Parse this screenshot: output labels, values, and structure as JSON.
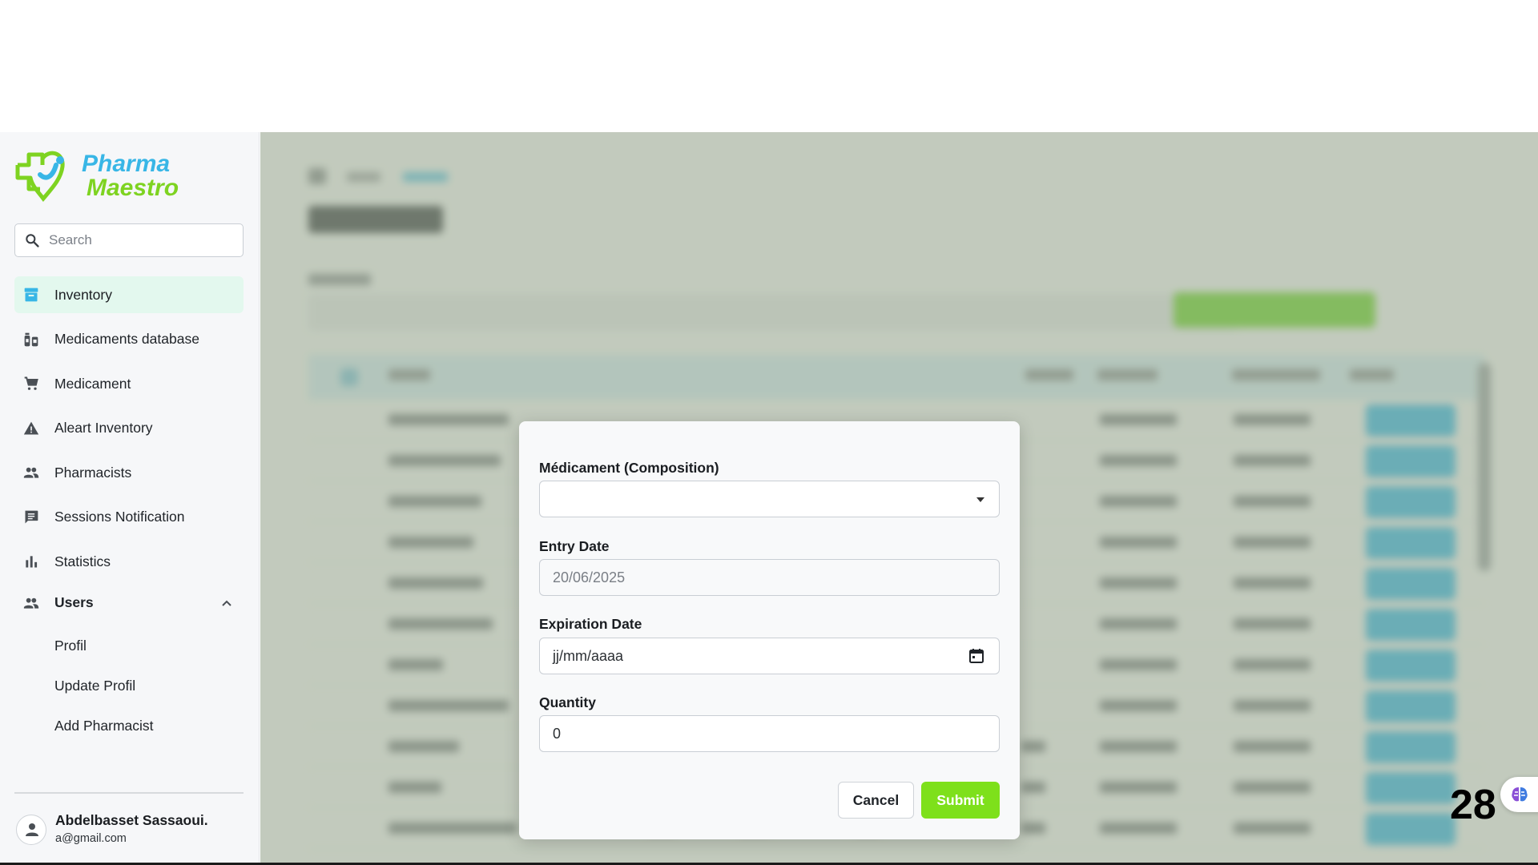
{
  "brand": {
    "line1": "Pharma",
    "line2": "Maestro",
    "color_green": "#7ed321",
    "color_blue": "#38b6e6"
  },
  "search": {
    "placeholder": "Search"
  },
  "sidebar": {
    "items": [
      {
        "label": "Inventory",
        "icon": "inventory-icon",
        "active": true
      },
      {
        "label": "Medicaments database",
        "icon": "medicaments-icon"
      },
      {
        "label": "Medicament",
        "icon": "cart-icon"
      },
      {
        "label": "Aleart Inventory",
        "icon": "warning-icon"
      },
      {
        "label": "Pharmacists",
        "icon": "people-icon"
      },
      {
        "label": "Sessions Notification",
        "icon": "chat-icon"
      },
      {
        "label": "Statistics",
        "icon": "bar-chart-icon"
      }
    ],
    "users": {
      "label": "Users",
      "expanded": true,
      "sub_items": [
        "Profil",
        "Update Profil",
        "Add Pharmacist"
      ]
    }
  },
  "user": {
    "name": "Abdelbasset Sassaoui.",
    "email": "a@gmail.com"
  },
  "modal": {
    "medicament": {
      "label": "Médicament (Composition)",
      "value": ""
    },
    "entry_date": {
      "label": "Entry Date",
      "value": "20/06/2025"
    },
    "expiration_date": {
      "label": "Expiration Date",
      "value": "jj/mm/aaaa"
    },
    "quantity": {
      "label": "Quantity",
      "value": "0"
    },
    "cancel_label": "Cancel",
    "submit_label": "Submit"
  },
  "colors": {
    "accent_green": "#7ee01b",
    "active_bg": "#e3f8ee",
    "table_btn": "#35b7e8"
  },
  "slide_number": "28"
}
